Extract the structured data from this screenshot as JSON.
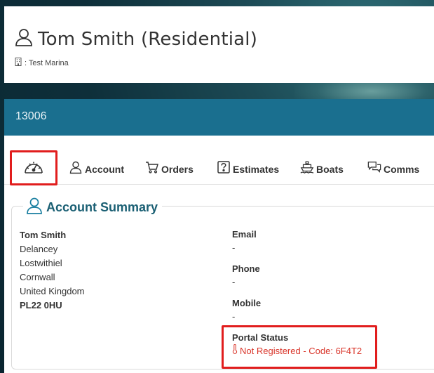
{
  "header": {
    "title": "Tom Smith (Residential)",
    "subtitle": ": Test Marina"
  },
  "record": {
    "id": "13006"
  },
  "tabs": [
    {
      "name": "dashboard",
      "label": ""
    },
    {
      "name": "account",
      "label": "Account"
    },
    {
      "name": "orders",
      "label": "Orders"
    },
    {
      "name": "estimates",
      "label": "Estimates"
    },
    {
      "name": "boats",
      "label": "Boats"
    },
    {
      "name": "comms",
      "label": "Comms"
    }
  ],
  "summary": {
    "heading": "Account Summary",
    "address": [
      "Tom Smith",
      "Delancey",
      "Lostwithiel",
      "Cornwall",
      "United Kingdom",
      "PL22 0HU"
    ],
    "email_label": "Email",
    "email_value": "-",
    "phone_label": "Phone",
    "phone_value": "-",
    "mobile_label": "Mobile",
    "mobile_value": "-",
    "portal_label": "Portal Status",
    "portal_value": "Not Registered - Code: 6F4T2"
  },
  "colors": {
    "brand_bar": "#1a6f8f",
    "heading": "#1a5f73",
    "alert": "#d9352a",
    "highlight": "#e11d1d"
  },
  "icons": {
    "title": "user-icon",
    "subtitle": "building-icon",
    "dashboard": "speedometer-icon",
    "account": "user-icon",
    "orders": "cart-icon",
    "estimates": "question-box-icon",
    "boats": "boat-icon",
    "comms": "chat-icon",
    "portal": "thermometer-icon"
  }
}
